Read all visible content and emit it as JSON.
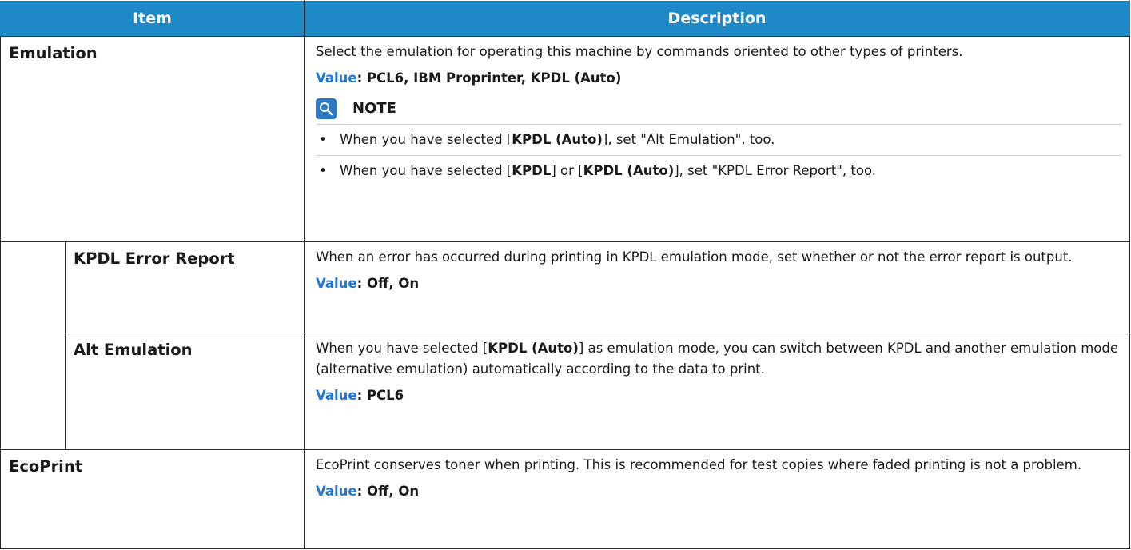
{
  "header": {
    "item": "Item",
    "description": "Description"
  },
  "rows": {
    "emulation": {
      "item": "Emulation",
      "desc": "Select the emulation for operating this machine by commands oriented to other types of printers.",
      "value_key": "Value",
      "value_text": ": PCL6, IBM Proprinter, KPDL (Auto)",
      "note_title": "NOTE",
      "note_icon": "note-lightbulb-icon",
      "notes": [
        {
          "pre": "When you have selected [",
          "b1": "KPDL (Auto)",
          "post": "], set \"Alt Emulation\", too."
        },
        {
          "pre": "When you have selected [",
          "b1": "KPDL",
          "mid": "] or [",
          "b2": "KPDL (Auto)",
          "post": "], set \"KPDL Error Report\", too."
        }
      ]
    },
    "kpdl_error": {
      "item": "KPDL Error Report",
      "desc": "When an error has occurred during printing in KPDL emulation mode, set whether or not the error report is output.",
      "value_key": "Value",
      "value_text": ": Off, On"
    },
    "alt_emulation": {
      "item": "Alt Emulation",
      "pre": "When you have selected [",
      "b1": "KPDL (Auto)",
      "post": "] as emulation mode, you can switch between KPDL and another emulation mode (alternative emulation) automatically according to the data to print.",
      "value_key": "Value",
      "value_text": ": PCL6"
    },
    "ecoprint": {
      "item": "EcoPrint",
      "desc": "EcoPrint conserves toner when printing. This is recommended for test copies where faded printing is not a problem.",
      "value_key": "Value",
      "value_text": ": Off, On"
    }
  },
  "colors": {
    "header_bg": "#1f88c7",
    "value_key": "#1f77d8",
    "note_icon_bg": "#2b79c2"
  }
}
